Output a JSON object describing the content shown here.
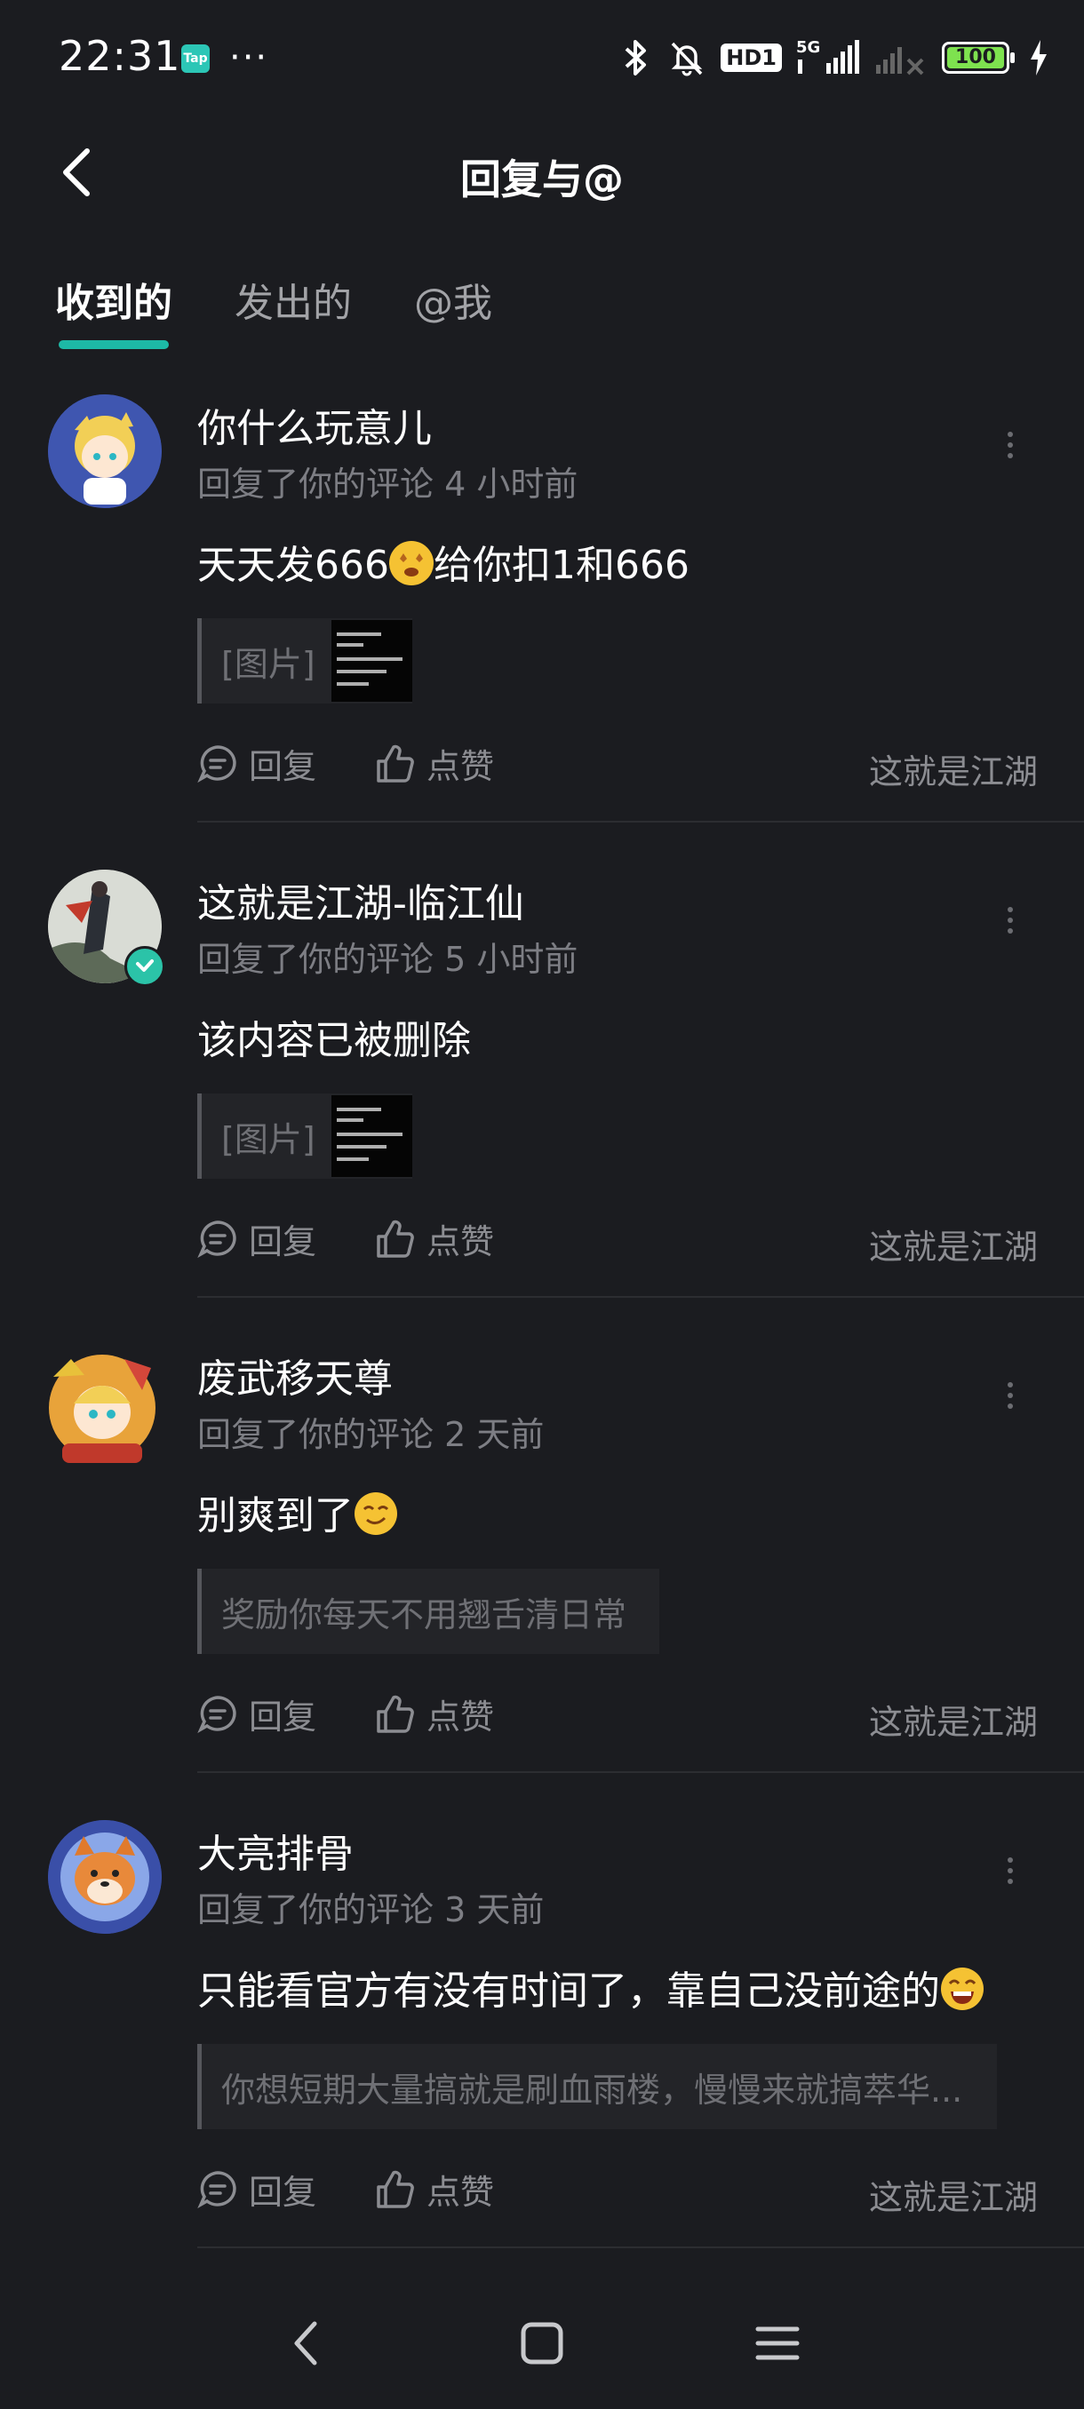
{
  "status_bar": {
    "time": "22:31",
    "app_icon": "Tap",
    "more": "···",
    "hd": "HD1",
    "network": "5G",
    "battery": "100"
  },
  "header": {
    "title": "回复与@"
  },
  "tabs": [
    {
      "label": "收到的",
      "active": true
    },
    {
      "label": "发出的",
      "active": false
    },
    {
      "label": "@我",
      "active": false
    }
  ],
  "items": [
    {
      "name": "你什么玩意儿",
      "meta": "回复了你的评论 4 小时前",
      "content": "天天发666",
      "content2": "给你扣1和666",
      "quote": "[图片]",
      "reply": "回复",
      "like": "点赞",
      "source": "这就是江湖"
    },
    {
      "name": "这就是江湖-临江仙",
      "meta": "回复了你的评论 5 小时前",
      "content": "该内容已被删除",
      "quote": "[图片]",
      "reply": "回复",
      "like": "点赞",
      "source": "这就是江湖"
    },
    {
      "name": "废武移天尊",
      "meta": "回复了你的评论 2 天前",
      "content": "别爽到了",
      "quote": "奖励你每天不用翘舌清日常",
      "reply": "回复",
      "like": "点赞",
      "source": "这就是江湖"
    },
    {
      "name": "大亮排骨",
      "meta": "回复了你的评论 3 天前",
      "content": "只能看官方有没有时间了，靠自己没前途的",
      "quote": "你想短期大量搞就是刷血雨楼，慢慢来就搞萃华...",
      "reply": "回复",
      "like": "点赞",
      "source": "这就是江湖"
    }
  ],
  "colors": {
    "background": "#1b1c20",
    "accent": "#1db9a6",
    "muted": "#8c8d92",
    "battery": "#7ee24f"
  }
}
